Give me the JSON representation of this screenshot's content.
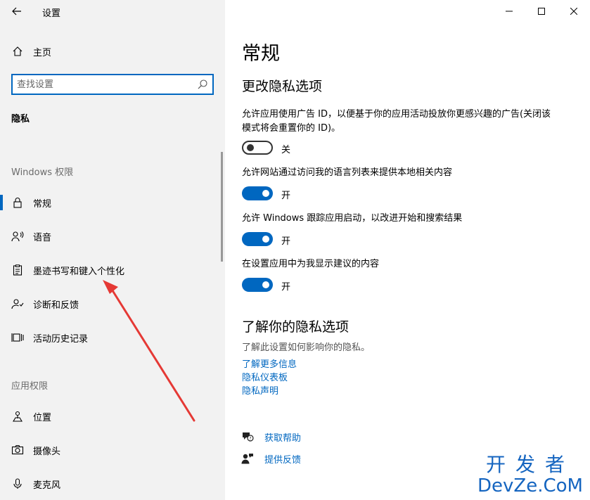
{
  "window": {
    "title": "设置"
  },
  "sidebar": {
    "home_label": "主页",
    "search_placeholder": "查找设置",
    "section_title": "隐私",
    "group_windows": "Windows 权限",
    "group_apps": "应用权限",
    "windows_items": [
      {
        "label": "常规",
        "icon": "lock-icon",
        "selected": true
      },
      {
        "label": "语音",
        "icon": "speech-icon",
        "selected": false
      },
      {
        "label": "墨迹书写和键入个性化",
        "icon": "clipboard-icon",
        "selected": false
      },
      {
        "label": "诊断和反馈",
        "icon": "diagnostics-icon",
        "selected": false
      },
      {
        "label": "活动历史记录",
        "icon": "timeline-icon",
        "selected": false
      }
    ],
    "app_items": [
      {
        "label": "位置",
        "icon": "location-icon"
      },
      {
        "label": "摄像头",
        "icon": "camera-icon"
      },
      {
        "label": "麦克风",
        "icon": "microphone-icon"
      }
    ]
  },
  "main": {
    "title": "常规",
    "subtitle": "更改隐私选项",
    "options": [
      {
        "text": "允许应用使用广告 ID，以便基于你的应用活动投放你更感兴趣的广告(关闭该模式将会重置你的 ID)。",
        "state": "关",
        "on": false
      },
      {
        "text": "允许网站通过访问我的语言列表来提供本地相关内容",
        "state": "开",
        "on": true
      },
      {
        "text": "允许 Windows 跟踪应用启动，以改进开始和搜索结果",
        "state": "开",
        "on": true
      },
      {
        "text": "在设置应用中为我显示建议的内容",
        "state": "开",
        "on": true
      }
    ],
    "learn_title": "了解你的隐私选项",
    "learn_desc": "了解此设置如何影响你的隐私。",
    "links": [
      "了解更多信息",
      "隐私仪表板",
      "隐私声明"
    ],
    "help_label": "获取帮助",
    "feedback_label": "提供反馈"
  },
  "watermark": {
    "line1": "开发者",
    "line2": "DevZe.CoM"
  },
  "colors": {
    "accent": "#0067c0",
    "sidebar_bg": "#f2f2f2",
    "annotation_arrow": "#e53935"
  }
}
